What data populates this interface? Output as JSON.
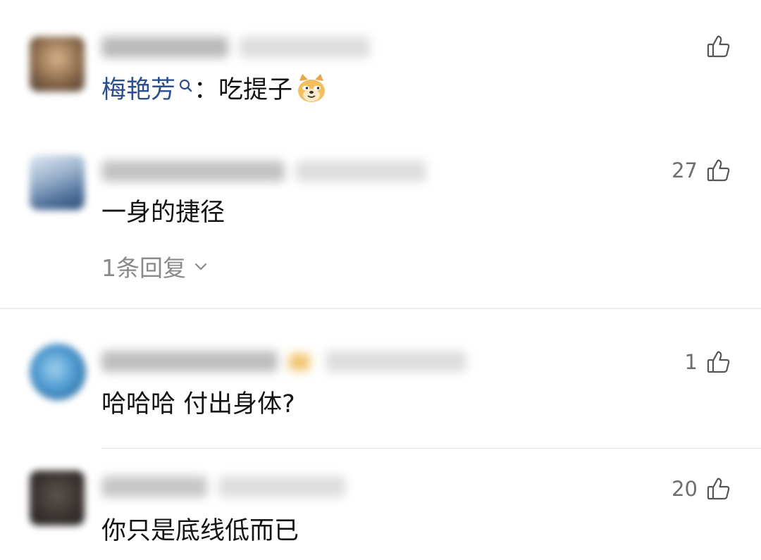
{
  "comments": [
    {
      "mention": "梅艳芳",
      "separator": "：",
      "text": "吃提子",
      "emoji": "doge-emoji",
      "likes": ""
    },
    {
      "text": "一身的捷径",
      "likes": "27",
      "replies_label": "1条回复"
    },
    {
      "text": "哈哈哈 付出身体?",
      "likes": "1"
    },
    {
      "text": "你只是底线低而已",
      "likes": "20"
    }
  ],
  "icons": {
    "like": "thumbs-up-icon",
    "search": "search-icon",
    "expand": "chevron-down-icon"
  },
  "colors": {
    "mention": "#2b4e8c",
    "text": "#141414",
    "secondary": "#8a8a8a"
  }
}
